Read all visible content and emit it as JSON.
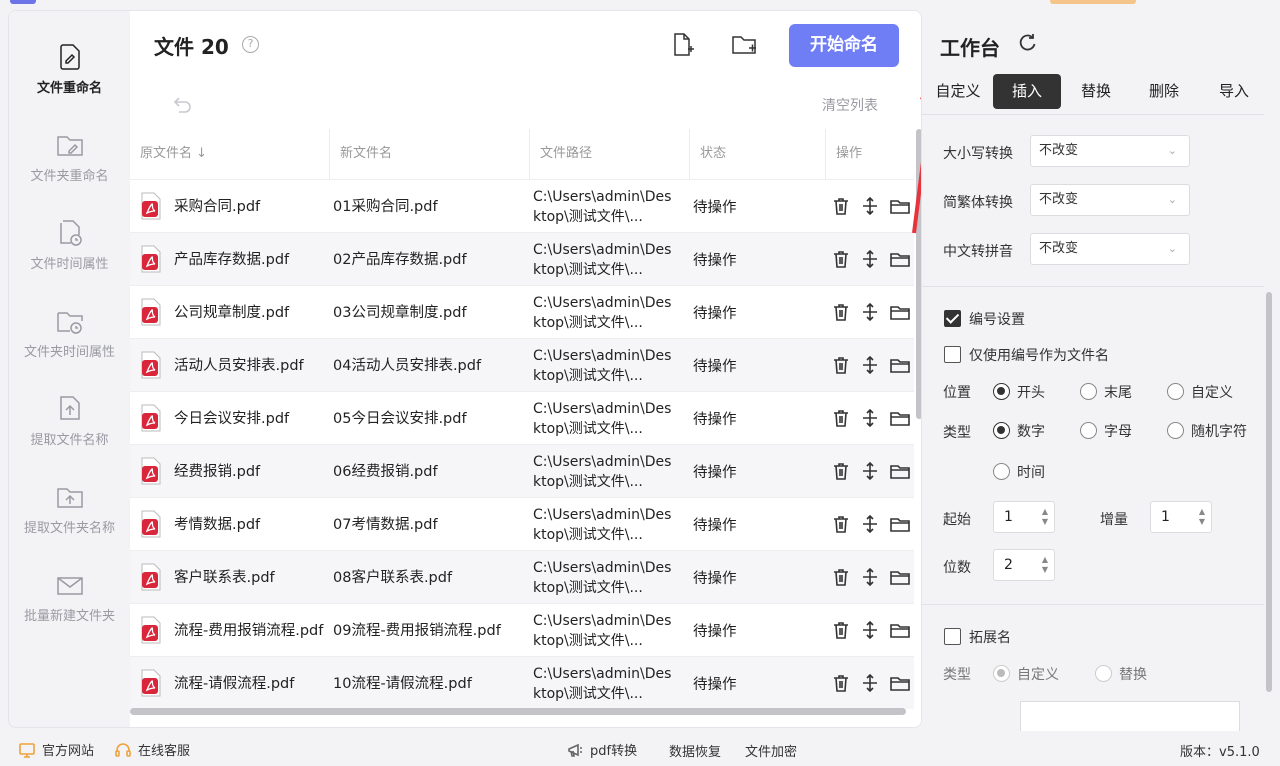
{
  "sidebar": {
    "items": [
      {
        "label": "文件重命名",
        "icon": "file-edit-icon",
        "active": true
      },
      {
        "label": "文件夹重命名",
        "icon": "folder-edit-icon"
      },
      {
        "label": "文件时间属性",
        "icon": "file-clock-icon"
      },
      {
        "label": "文件夹时间属性",
        "icon": "folder-clock-icon"
      },
      {
        "label": "提取文件名称",
        "icon": "file-upload-icon"
      },
      {
        "label": "提取文件夹名称",
        "icon": "folder-upload-icon"
      },
      {
        "label": "批量新建文件夹",
        "icon": "mail-icon"
      }
    ]
  },
  "header": {
    "title": "文件 20",
    "start_button": "开始命名",
    "clear_list": "清空列表"
  },
  "table": {
    "columns": [
      "原文件名 ↓",
      "新文件名",
      "文件路径",
      "状态",
      "操作"
    ],
    "rows": [
      {
        "original": "采购合同.pdf",
        "new": "01采购合同.pdf",
        "path": "C:\\Users\\admin\\Desktop\\测试文件\\...",
        "status": "待操作"
      },
      {
        "original": "产品库存数据.pdf",
        "new": "02产品库存数据.pdf",
        "path": "C:\\Users\\admin\\Desktop\\测试文件\\...",
        "status": "待操作"
      },
      {
        "original": "公司规章制度.pdf",
        "new": "03公司规章制度.pdf",
        "path": "C:\\Users\\admin\\Desktop\\测试文件\\...",
        "status": "待操作"
      },
      {
        "original": "活动人员安排表.pdf",
        "new": "04活动人员安排表.pdf",
        "path": "C:\\Users\\admin\\Desktop\\测试文件\\...",
        "status": "待操作"
      },
      {
        "original": "今日会议安排.pdf",
        "new": "05今日会议安排.pdf",
        "path": "C:\\Users\\admin\\Desktop\\测试文件\\...",
        "status": "待操作"
      },
      {
        "original": "经费报销.pdf",
        "new": "06经费报销.pdf",
        "path": "C:\\Users\\admin\\Desktop\\测试文件\\...",
        "status": "待操作"
      },
      {
        "original": "考情数据.pdf",
        "new": "07考情数据.pdf",
        "path": "C:\\Users\\admin\\Desktop\\测试文件\\...",
        "status": "待操作"
      },
      {
        "original": "客户联系表.pdf",
        "new": "08客户联系表.pdf",
        "path": "C:\\Users\\admin\\Desktop\\测试文件\\...",
        "status": "待操作"
      },
      {
        "original": "流程-费用报销流程.pdf",
        "new": "09流程-费用报销流程.pdf",
        "path": "C:\\Users\\admin\\Desktop\\测试文件\\...",
        "status": "待操作"
      },
      {
        "original": "流程-请假流程.pdf",
        "new": "10流程-请假流程.pdf",
        "path": "C:\\Users\\admin\\Desktop\\测试文件\\...",
        "status": "待操作"
      }
    ]
  },
  "workbench": {
    "title": "工作台",
    "tabs": [
      "自定义",
      "插入",
      "替换",
      "删除",
      "导入"
    ],
    "active_tab": "插入",
    "case_label": "大小写转换",
    "case_value": "不改变",
    "trad_label": "简繁体转换",
    "trad_value": "不改变",
    "pinyin_label": "中文转拼音",
    "pinyin_value": "不改变",
    "numbering_label": "编号设置",
    "only_number_label": "仅使用编号作为文件名",
    "position_label": "位置",
    "position_options": [
      "开头",
      "末尾",
      "自定义"
    ],
    "type_label": "类型",
    "type_options": [
      "数字",
      "字母",
      "随机字符",
      "时间"
    ],
    "start_label": "起始",
    "start_value": "1",
    "increment_label": "增量",
    "increment_value": "1",
    "digits_label": "位数",
    "digits_value": "2",
    "ext_label": "拓展名",
    "ext_type_label": "类型",
    "ext_type_options": [
      "自定义",
      "替换"
    ]
  },
  "footer": {
    "website": "官方网站",
    "service": "在线客服",
    "pdf": "pdf转换",
    "recovery": "数据恢复",
    "encrypt": "文件加密",
    "version": "版本：v5.1.0"
  },
  "colors": {
    "accent": "#6f7ef5",
    "arrow": "#e8323c",
    "pdf_red": "#d9263b"
  }
}
